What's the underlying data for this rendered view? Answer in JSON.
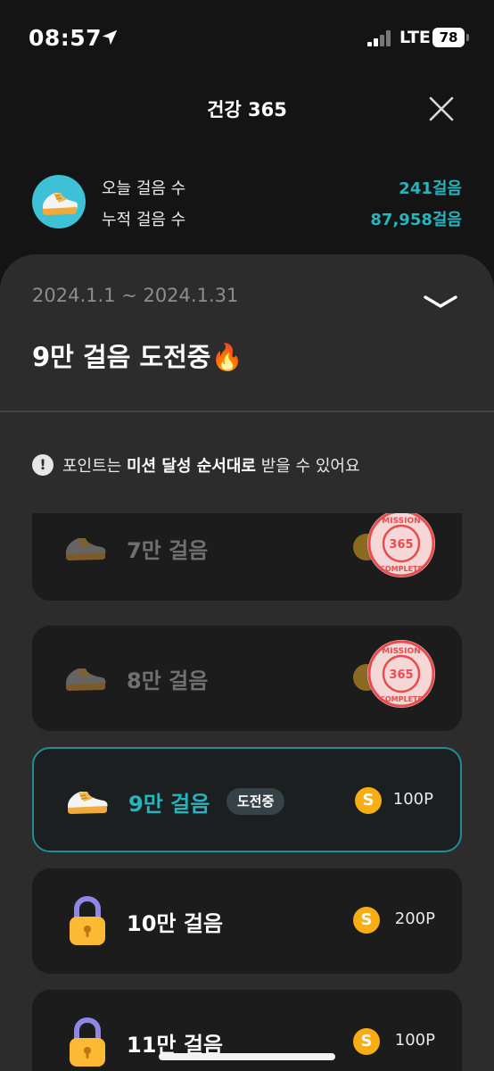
{
  "status_bar": {
    "time": "08:57",
    "network": "LTE",
    "battery": "78"
  },
  "header": {
    "title": "건강 365"
  },
  "stats": {
    "today_label": "오늘 걸음 수",
    "today_value": "241걸음",
    "total_label": "누적 걸음 수",
    "total_value": "87,958걸음"
  },
  "challenge": {
    "date_range": "2024.1.1 ~ 2024.1.31",
    "title": "9만 걸음 도전중🔥"
  },
  "notice": {
    "prefix": "포인트는 ",
    "bold": "미션 달성 순서대로",
    "suffix": " 받을 수 있어요"
  },
  "missions": [
    {
      "label": "7만 걸음",
      "state": "complete",
      "stamp_top": "MISSION",
      "stamp_mid": "365",
      "stamp_bottom": "COMPLETE"
    },
    {
      "label": "8만 걸음",
      "state": "complete",
      "stamp_top": "MISSION",
      "stamp_mid": "365",
      "stamp_bottom": "COMPLETE"
    },
    {
      "label": "9만 걸음",
      "state": "in-progress",
      "badge": "도전중",
      "coin": "S",
      "points": "100P"
    },
    {
      "label": "10만 걸음",
      "state": "locked",
      "coin": "S",
      "points": "200P"
    },
    {
      "label": "11만 걸음",
      "state": "locked",
      "coin": "S",
      "points": "100P"
    }
  ],
  "colors": {
    "accent": "#27b4bc",
    "coin": "#f8ad14",
    "stamp": "#e84c4c",
    "sheet": "#2c2c2c",
    "background": "#141414"
  },
  "icons": [
    "location-arrow-icon",
    "signal-icon",
    "battery-icon",
    "close-icon",
    "sneaker-icon",
    "chevron-down-icon",
    "info-icon",
    "coin-icon",
    "lock-icon",
    "mission-complete-stamp"
  ]
}
